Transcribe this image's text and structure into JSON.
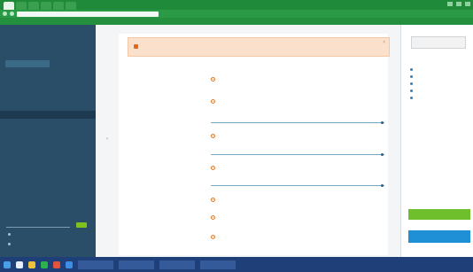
{
  "browser": {
    "tabs": [
      "",
      "",
      "",
      "",
      "",
      ""
    ],
    "url": "",
    "bookmarks": [
      "",
      "",
      "",
      "",
      "",
      "",
      "",
      "",
      "",
      ""
    ]
  },
  "sidebar": {
    "logo_part1": "",
    "logo_part2": "",
    "company": "",
    "items": [
      {
        "label": "",
        "active": true
      },
      {
        "label": "",
        "active": false
      },
      {
        "label": "",
        "active": false
      },
      {
        "label": "",
        "active": false
      }
    ],
    "links": [
      "",
      ""
    ]
  },
  "alert": {
    "text": ""
  },
  "form": {
    "rows": [
      {
        "label": "",
        "value": ""
      },
      {
        "label": "",
        "value": ""
      },
      {
        "label": ""
      },
      {
        "value": ""
      },
      {
        "label": ""
      },
      {
        "value": ""
      },
      {
        "label": ""
      },
      {
        "label": "",
        "value": ""
      },
      {
        "label": "",
        "value": ""
      },
      {
        "label": "",
        "value": ""
      }
    ]
  },
  "rightpanel": {
    "top_button": "",
    "title": "",
    "items": [
      "",
      "",
      "",
      "",
      ""
    ],
    "green_button": "",
    "blue_button": ""
  },
  "taskbar": {
    "windows": [
      "",
      "",
      "",
      ""
    ],
    "time": "",
    "date": ""
  },
  "colors": {
    "sidebar": "#2a4e67",
    "browser_green": "#1f8a3a",
    "accent_orange": "#e07a2a",
    "alert_bg": "#fbe1cc",
    "green_button": "#6fbe2b",
    "blue_button": "#1f8fd6",
    "taskbar": "#1f3f78"
  }
}
